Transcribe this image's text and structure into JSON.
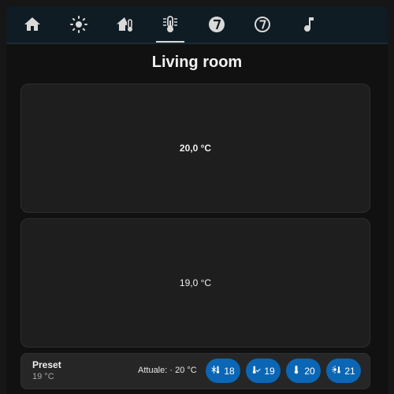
{
  "nav": {
    "items": [
      {
        "icon": "home-icon"
      },
      {
        "icon": "sun-icon"
      },
      {
        "icon": "home-thermometer-icon"
      },
      {
        "icon": "thermometer-lines-icon",
        "active": true
      },
      {
        "icon": "number-7-circle-icon"
      },
      {
        "icon": "number-7-outline-icon"
      },
      {
        "icon": "music-note-icon"
      }
    ]
  },
  "page": {
    "title": "Living room"
  },
  "cards": [
    {
      "value": "20,0 °C"
    },
    {
      "value": "19,0 °C"
    }
  ],
  "preset": {
    "label": "Preset",
    "value": "19 °C",
    "current": "Attuale: · 20 °C",
    "buttons": [
      {
        "icon": "snowflake-thermometer-icon",
        "value": "18"
      },
      {
        "icon": "thermometer-check-icon",
        "value": "19"
      },
      {
        "icon": "thermometer-icon",
        "value": "20"
      },
      {
        "icon": "sun-thermometer-icon",
        "value": "21"
      }
    ]
  },
  "colors": {
    "accent": "#0b67b5",
    "topbar": "#101c24",
    "card": "#1e1e1e",
    "background": "#111111"
  }
}
